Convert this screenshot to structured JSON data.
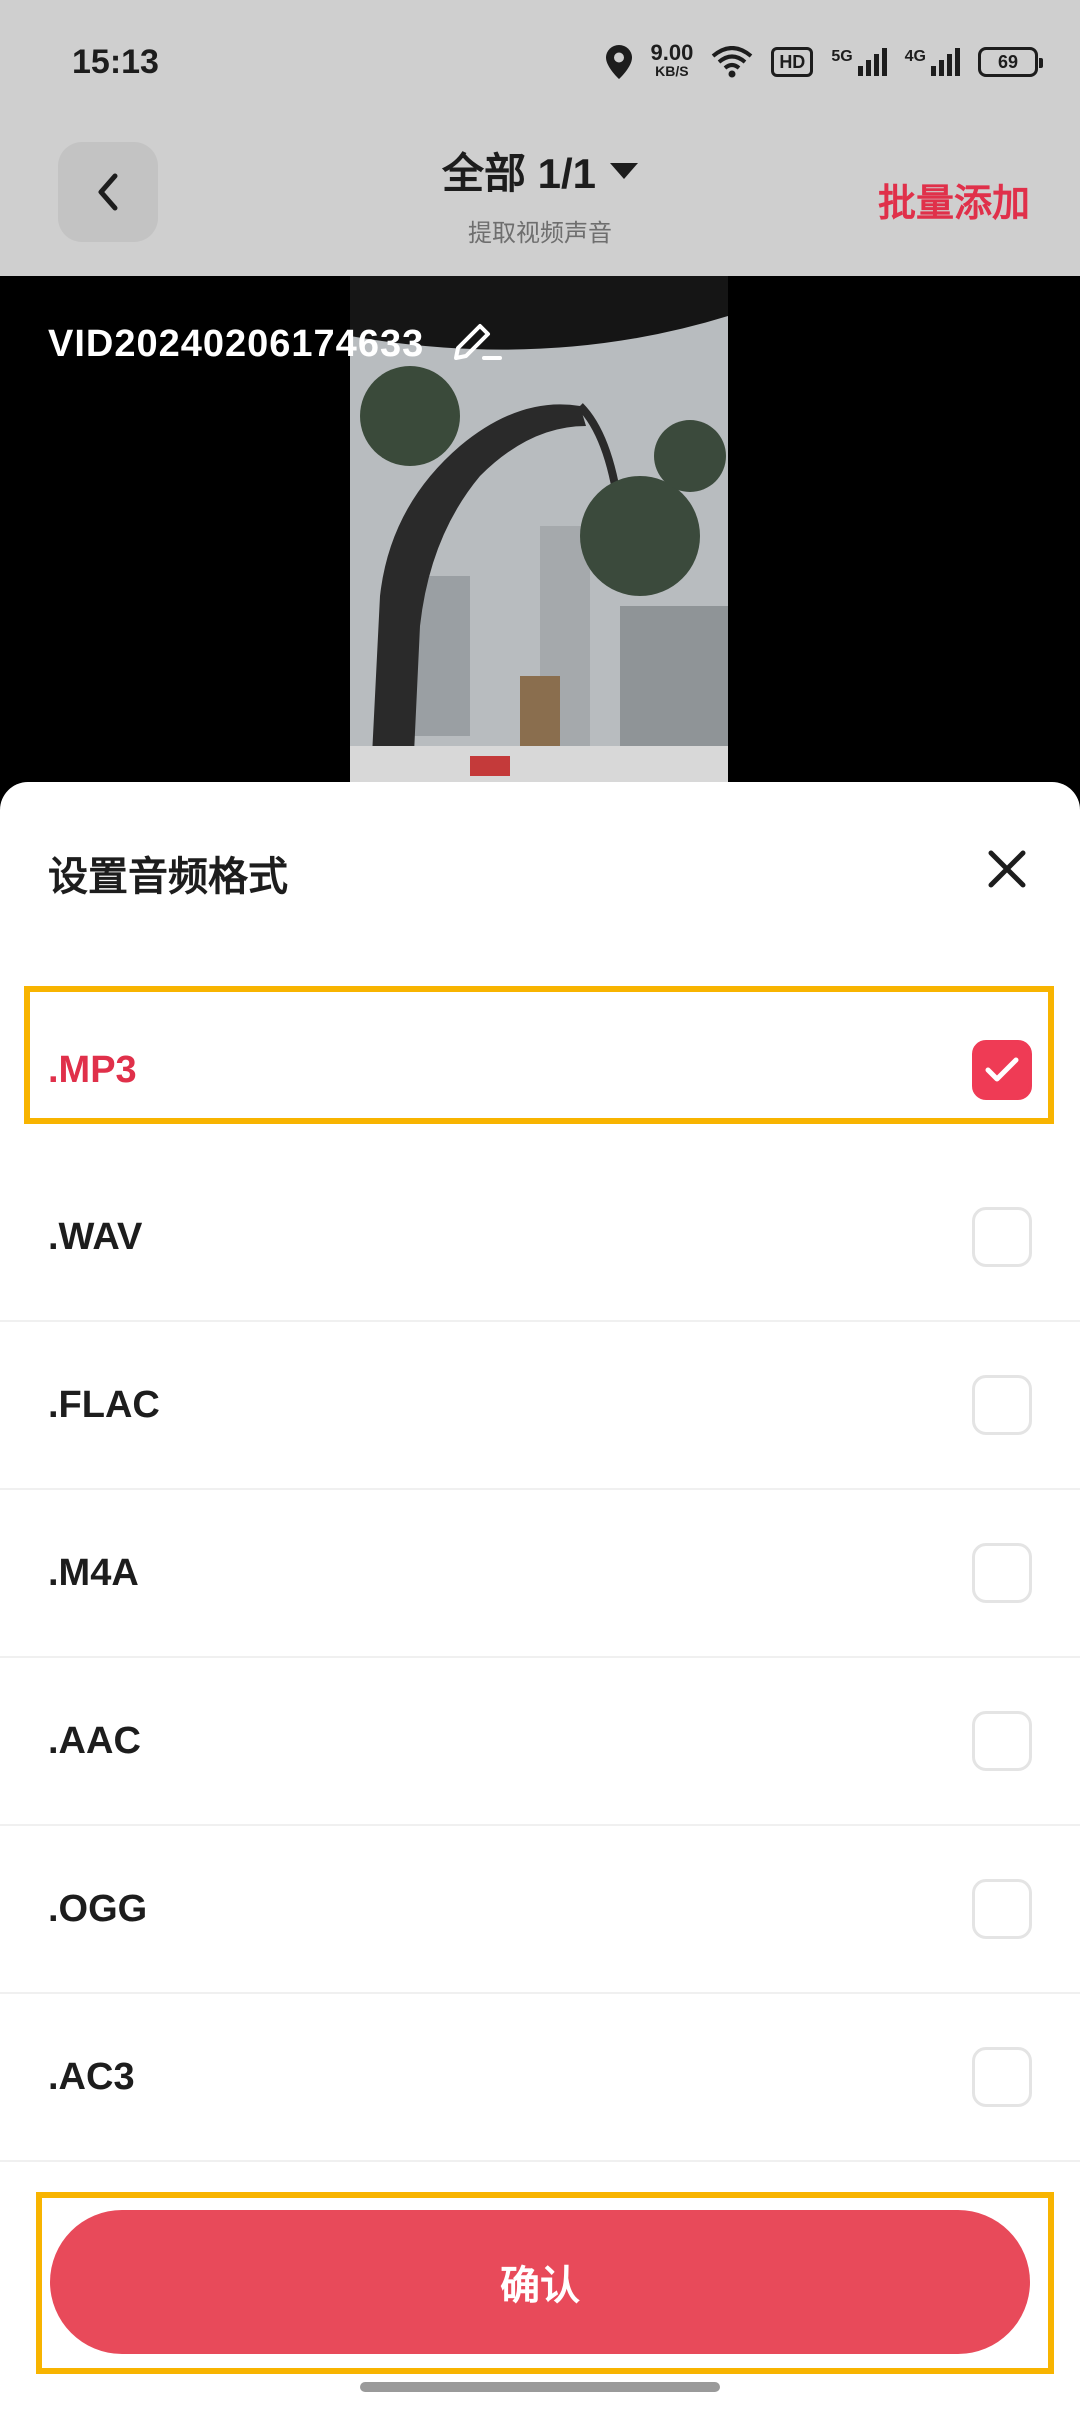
{
  "status_bar": {
    "time": "15:13",
    "net_speed_value": "9.00",
    "net_speed_unit": "KB/S",
    "hd_label": "HD",
    "signal1_type": "5G",
    "signal2_type": "4G",
    "battery": "69"
  },
  "header": {
    "title": "全部 1/1",
    "subtitle": "提取视频声音",
    "batch_add": "批量添加"
  },
  "preview": {
    "file_name": "VID20240206174633"
  },
  "sheet": {
    "title": "设置音频格式",
    "options": [
      {
        "label": ".MP3",
        "selected": true
      },
      {
        "label": ".WAV",
        "selected": false
      },
      {
        "label": ".FLAC",
        "selected": false
      },
      {
        "label": ".M4A",
        "selected": false
      },
      {
        "label": ".AAC",
        "selected": false
      },
      {
        "label": ".OGG",
        "selected": false
      },
      {
        "label": ".AC3",
        "selected": false
      }
    ],
    "confirm": "确认"
  },
  "colors": {
    "accent": "#e0304a",
    "confirm_bg": "#e84a5a",
    "highlight": "#f8b400"
  }
}
